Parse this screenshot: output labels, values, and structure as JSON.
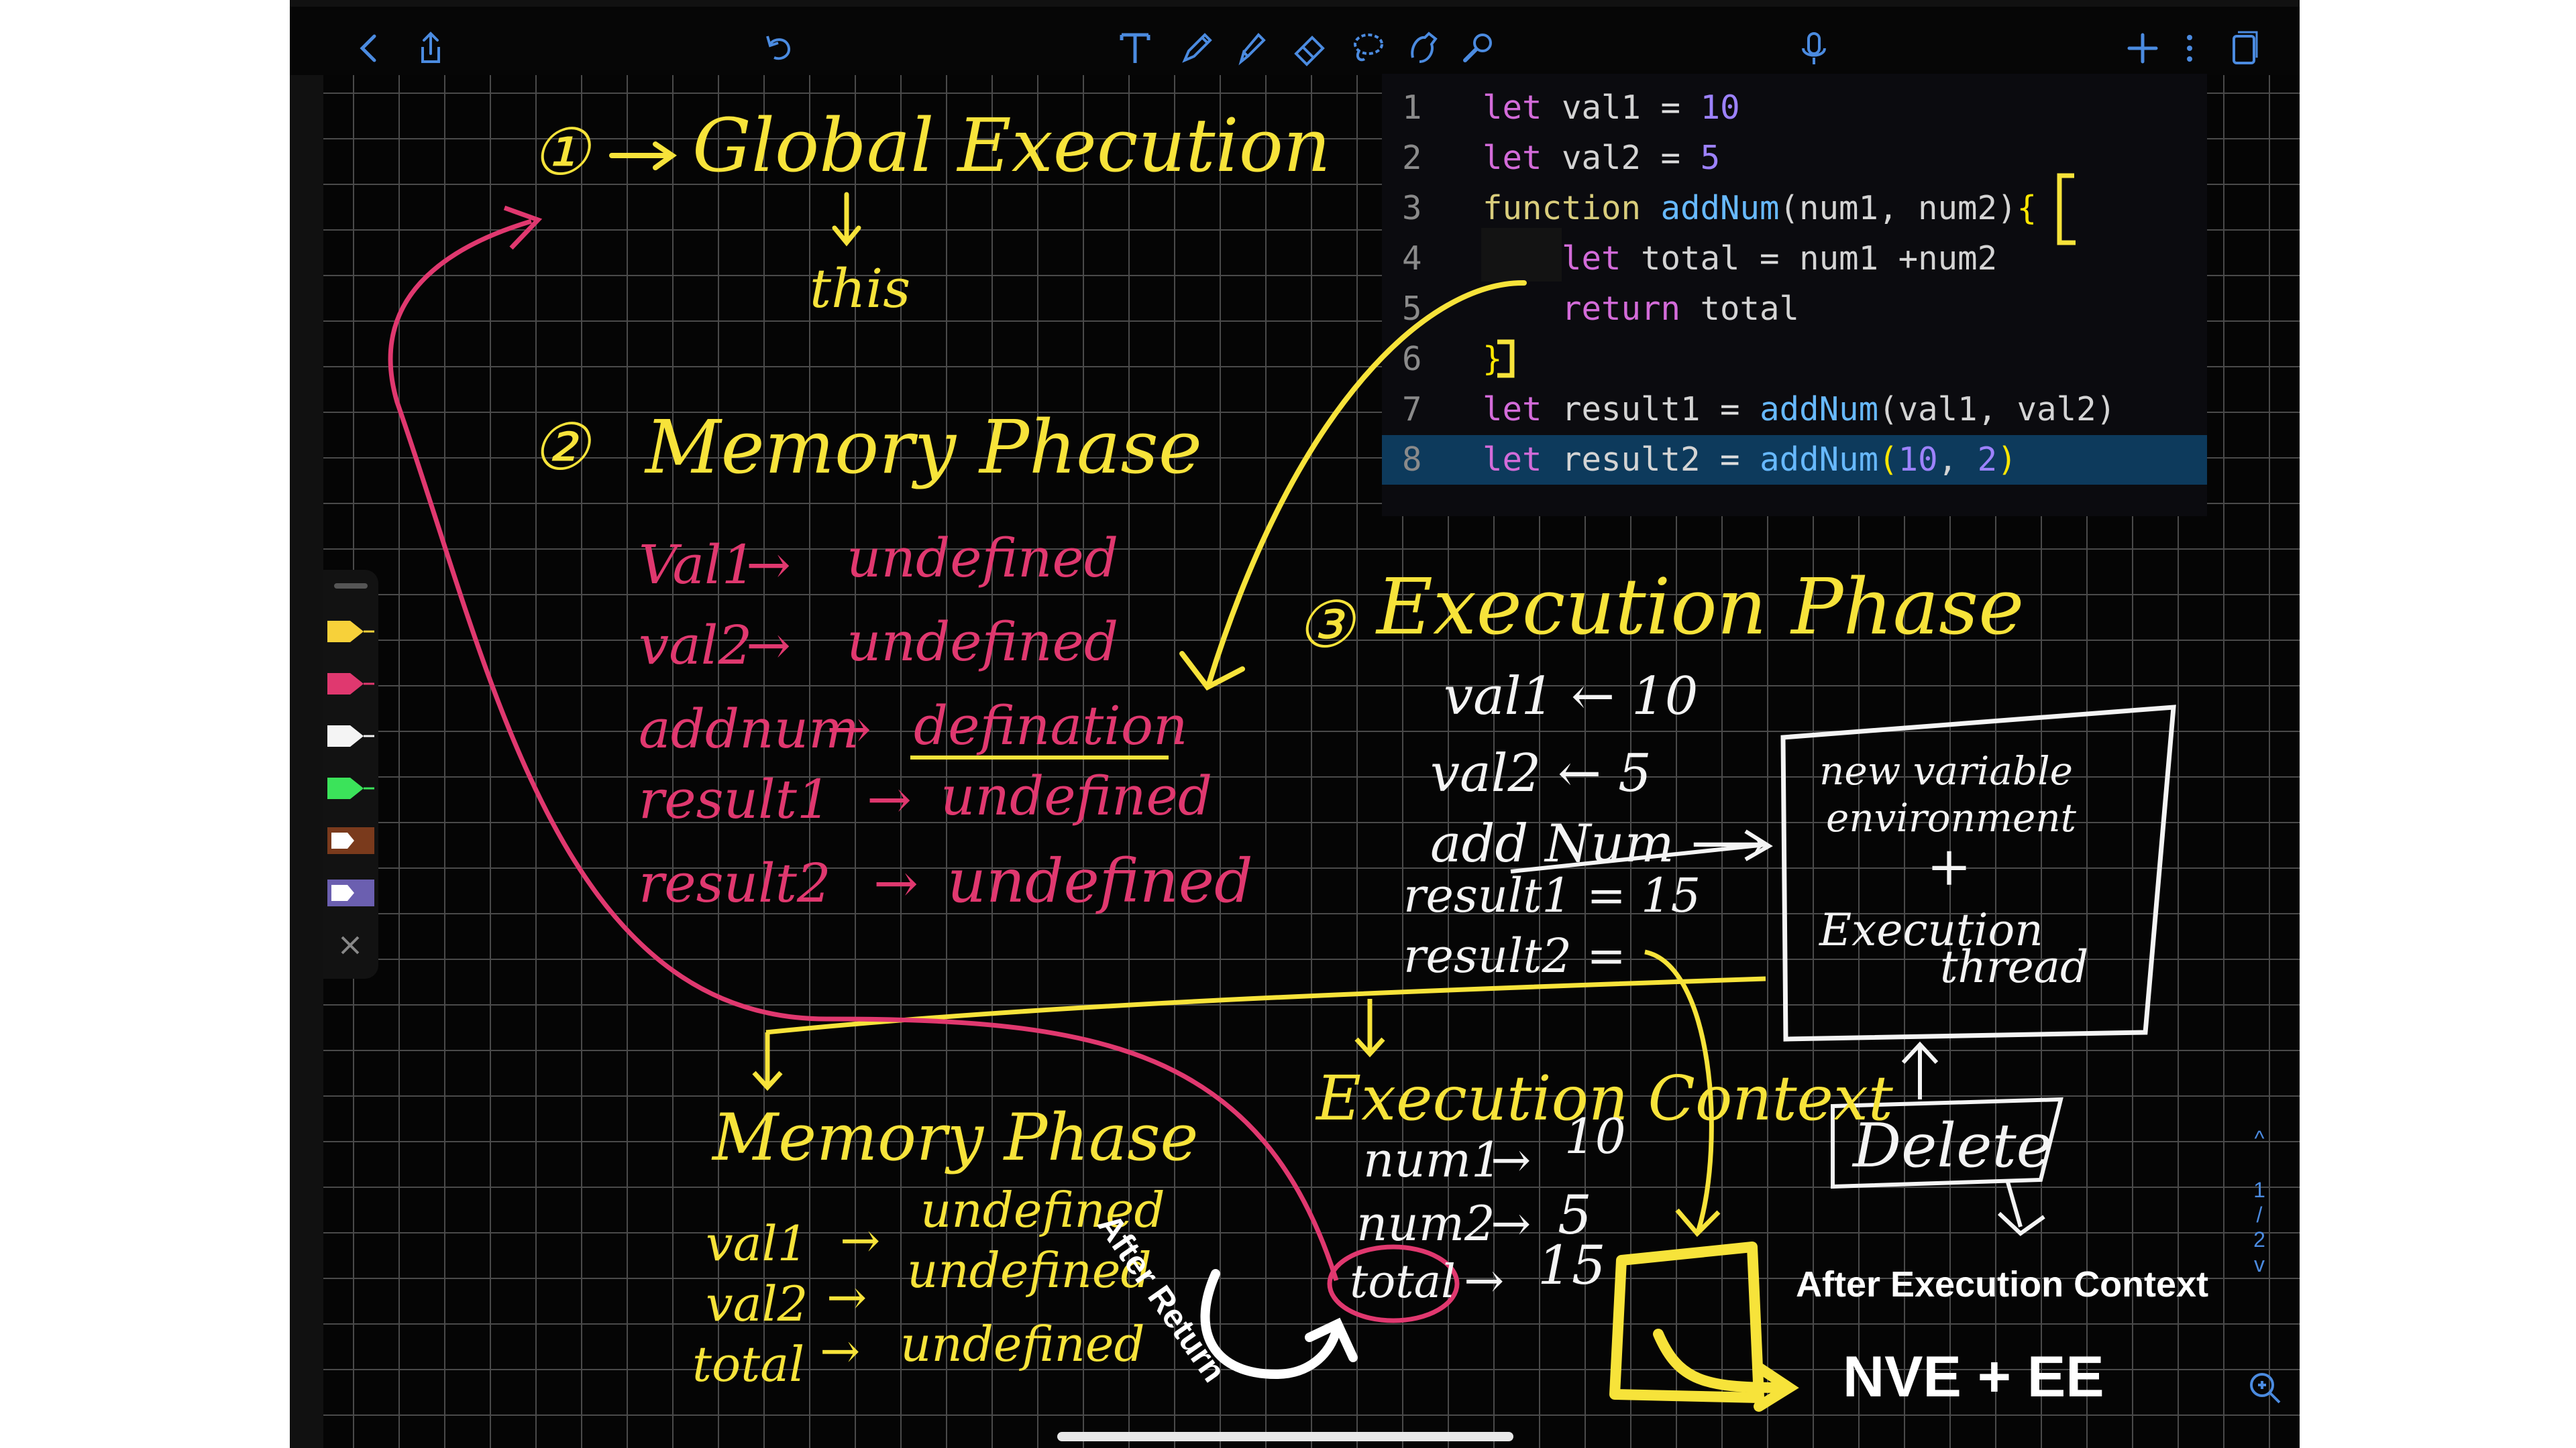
{
  "toolbar": {
    "icons": [
      "back-icon",
      "share-icon",
      "undo-icon",
      "text-tool-icon",
      "pen-icon",
      "highlighter-icon",
      "eraser-icon",
      "lasso-icon",
      "shape-icon",
      "laser-icon",
      "mic-icon",
      "add-icon",
      "more-icon",
      "pages-icon"
    ]
  },
  "code": {
    "lines": [
      {
        "n": "1",
        "parts": [
          [
            "kw",
            "let"
          ],
          [
            "t",
            " val1 "
          ],
          [
            "punct",
            "="
          ],
          [
            "t",
            " "
          ],
          [
            "num",
            "10"
          ]
        ]
      },
      {
        "n": "2",
        "parts": [
          [
            "kw",
            "let"
          ],
          [
            "t",
            " val2 "
          ],
          [
            "punct",
            "="
          ],
          [
            "t",
            " "
          ],
          [
            "num",
            "5"
          ]
        ]
      },
      {
        "n": "3",
        "parts": [
          [
            "fn",
            "function"
          ],
          [
            "t",
            " "
          ],
          [
            "fnname",
            "addNum"
          ],
          [
            "t",
            "(num1, num2)"
          ],
          [
            "brace",
            "{"
          ]
        ]
      },
      {
        "n": "4",
        "parts": [
          [
            "t",
            "    "
          ],
          [
            "kw",
            "let"
          ],
          [
            "t",
            " total "
          ],
          [
            "punct",
            "="
          ],
          [
            "t",
            " num1 +num2"
          ]
        ]
      },
      {
        "n": "5",
        "parts": [
          [
            "t",
            "    "
          ],
          [
            "kw",
            "return"
          ],
          [
            "t",
            " total"
          ]
        ]
      },
      {
        "n": "6",
        "parts": [
          [
            "brace",
            "}"
          ]
        ]
      },
      {
        "n": "7",
        "parts": [
          [
            "kw",
            "let"
          ],
          [
            "t",
            " result1 "
          ],
          [
            "punct",
            "="
          ],
          [
            "t",
            " "
          ],
          [
            "fnname",
            "addNum"
          ],
          [
            "t",
            "(val1, val2)"
          ]
        ]
      },
      {
        "n": "8",
        "parts": [
          [
            "kw",
            "let"
          ],
          [
            "t",
            " result2 "
          ],
          [
            "punct",
            "="
          ],
          [
            "t",
            " "
          ],
          [
            "fnname",
            "addNum"
          ],
          [
            "brace",
            "("
          ],
          [
            "num",
            "10"
          ],
          [
            "t",
            ", "
          ],
          [
            "num",
            "2"
          ],
          [
            "brace",
            ")"
          ]
        ]
      }
    ]
  },
  "notes": {
    "global": {
      "num": "①",
      "title": "Global Execution",
      "sub": "this"
    },
    "memory": {
      "num": "②",
      "title": "Memory Phase",
      "rows": [
        {
          "name": "Val1",
          "value": "undefined"
        },
        {
          "name": "val2",
          "value": "undefined"
        },
        {
          "name": "addnum",
          "value": "defination"
        },
        {
          "name": "result1",
          "value": "undefined"
        },
        {
          "name": "result2",
          "value": "undefined"
        }
      ]
    },
    "execution": {
      "num": "③",
      "title": "Execution Phase",
      "rows": [
        {
          "text": "val1 ← 10"
        },
        {
          "text": "val2 ← 5"
        },
        {
          "text": "add Num ⟶"
        },
        {
          "text": "result1 = 15"
        },
        {
          "text": "result2 ="
        }
      ]
    },
    "box": {
      "line1": "new variable",
      "line2": "environment",
      "plus": "+",
      "line3": "Execution",
      "line4": "thread"
    },
    "delete_label": "Delete",
    "exec_context": {
      "title": "Execution Context",
      "rows": [
        {
          "name": "num1",
          "value": "10"
        },
        {
          "name": "num2",
          "value": "5"
        },
        {
          "name": "total",
          "value": "15"
        }
      ]
    },
    "memory2": {
      "title": "Memory Phase",
      "rows": [
        {
          "name": "val1",
          "value": "undefined"
        },
        {
          "name": "val2",
          "value": "undefined"
        },
        {
          "name": "total",
          "value": "undefined"
        }
      ]
    }
  },
  "captions": {
    "after_return": "After Return",
    "after_ec": "After Execution Context",
    "nve_ee": "NVE + EE"
  },
  "page_nav": {
    "up": "^",
    "page1": "1",
    "sep": "/",
    "page2": "2",
    "down": "v"
  },
  "colors": {
    "yellow": "#f7e33a",
    "pink": "#e0386f",
    "white": "#f4f4f4",
    "green": "#3be35a",
    "brown": "#7a3a1c",
    "purple": "#6b5fb0"
  }
}
